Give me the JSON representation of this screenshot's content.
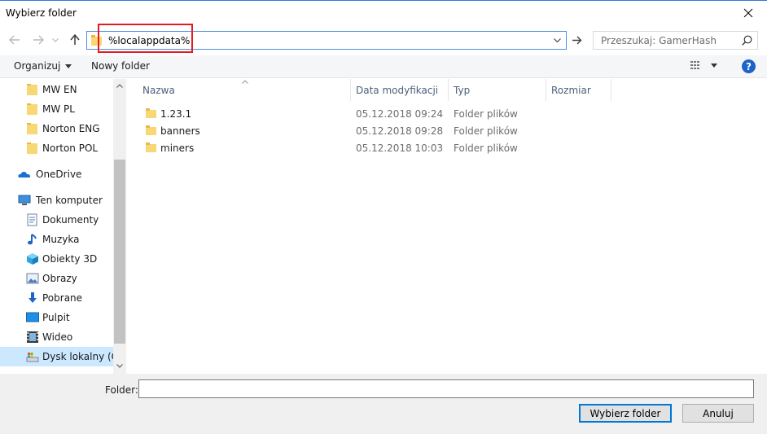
{
  "window": {
    "title": "Wybierz folder"
  },
  "address": {
    "path": "%localappdata%"
  },
  "search": {
    "placeholder": "Przeszukaj: GamerHash"
  },
  "toolbar": {
    "organize_label": "Organizuj",
    "new_folder_label": "Nowy folder"
  },
  "nav": {
    "items": [
      {
        "label": "MW EN",
        "icon": "folder-icon"
      },
      {
        "label": "MW PL",
        "icon": "folder-icon"
      },
      {
        "label": "Norton ENG",
        "icon": "folder-icon"
      },
      {
        "label": "Norton POL",
        "icon": "folder-icon"
      },
      {
        "label": "OneDrive",
        "icon": "onedrive-icon"
      },
      {
        "label": "Ten komputer",
        "icon": "computer-icon"
      },
      {
        "label": "Dokumenty",
        "icon": "documents-icon"
      },
      {
        "label": "Muzyka",
        "icon": "music-icon"
      },
      {
        "label": "Obiekty 3D",
        "icon": "objects-3d-icon"
      },
      {
        "label": "Obrazy",
        "icon": "pictures-icon"
      },
      {
        "label": "Pobrane",
        "icon": "downloads-icon"
      },
      {
        "label": "Pulpit",
        "icon": "desktop-icon"
      },
      {
        "label": "Wideo",
        "icon": "video-icon"
      },
      {
        "label": "Dysk lokalny (C:)",
        "icon": "drive-icon",
        "selected": true
      }
    ]
  },
  "list": {
    "columns": [
      "Nazwa",
      "Data modyfikacji",
      "Typ",
      "Rozmiar"
    ],
    "rows": [
      {
        "name": "1.23.1",
        "date": "05.12.2018 09:24",
        "type": "Folder plików"
      },
      {
        "name": "banners",
        "date": "05.12.2018 09:28",
        "type": "Folder plików"
      },
      {
        "name": "miners",
        "date": "05.12.2018 10:03",
        "type": "Folder plików"
      }
    ]
  },
  "footer": {
    "folder_label": "Folder:",
    "folder_value": "",
    "select_button": "Wybierz folder",
    "cancel_button": "Anuluj"
  },
  "colors": {
    "accent": "#0078d7",
    "highlight_box": "#e41b23",
    "folder": "#f8d775",
    "selection": "#cce8ff"
  }
}
